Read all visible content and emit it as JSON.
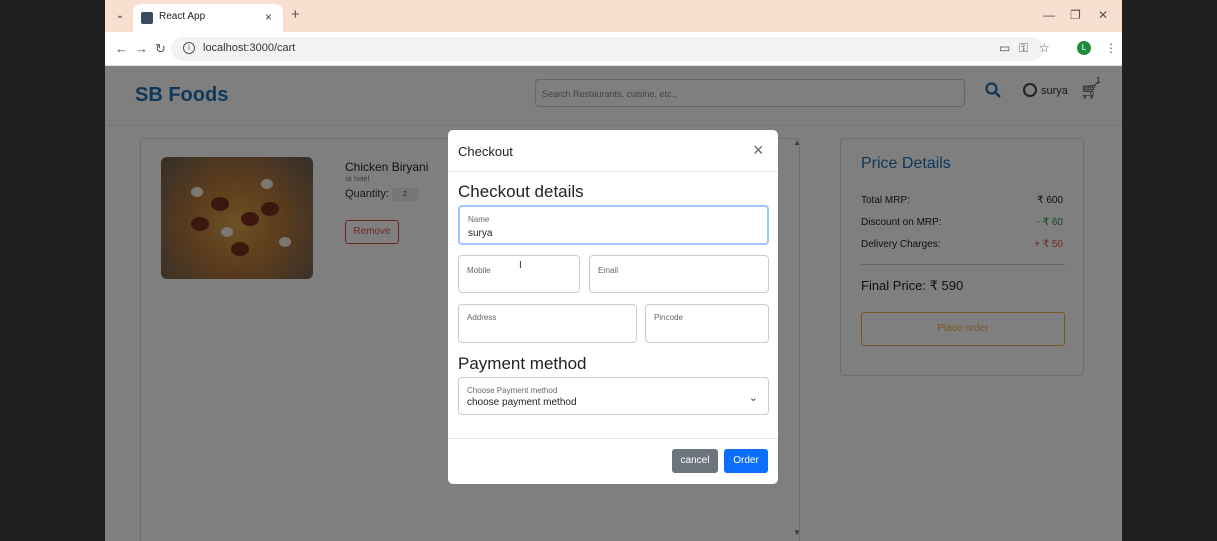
{
  "browser": {
    "tab_title": "React App",
    "tab_close": "×",
    "new_tab": "+",
    "url": "localhost:3000/cart",
    "profile_initial": "L"
  },
  "header": {
    "brand": "SB Foods",
    "search_placeholder": "Search Restaurants, cuisine, etc.,",
    "username": "surya",
    "cart_count": "1"
  },
  "cart": {
    "item_name": "Chicken Biryani",
    "hotel": "sk hotel",
    "quantity_label": "Quantity:",
    "quantity_value": "2",
    "remove_label": "Remove"
  },
  "price_details": {
    "title": "Price Details",
    "total_mrp_label": "Total MRP:",
    "total_mrp_value": "₹ 600",
    "discount_label": "Discount on MRP:",
    "discount_value": "- ₹ 60",
    "delivery_label": "Delivery Charges:",
    "delivery_value": "+ ₹ 50",
    "final_price": "Final Price: ₹ 590",
    "place_order_label": "Place order"
  },
  "modal": {
    "title": "Checkout",
    "close": "×",
    "details_heading": "Checkout details",
    "name_label": "Name",
    "name_value": "surya",
    "mobile_label": "Mobile",
    "email_label": "Email",
    "address_label": "Address",
    "pincode_label": "Pincode",
    "payment_heading": "Payment method",
    "payment_label": "Choose Payment method",
    "payment_value": "choose payment method",
    "cancel_label": "cancel",
    "order_label": "Order"
  },
  "colors": {
    "brand": "#1f6fb2",
    "discount": "#1e8e3e",
    "delivery": "#d9534f",
    "order_button": "#0d6efd",
    "cancel_button": "#6c757d",
    "place_order": "#f0ad4e"
  }
}
